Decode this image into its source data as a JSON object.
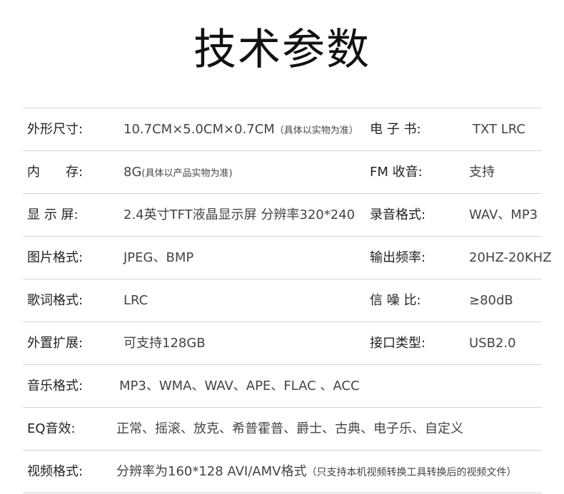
{
  "title": "技术参数",
  "rows": [
    {
      "left_label": "外形尺寸:",
      "left_value": "10.7CM×5.0CM×0.7CM",
      "left_note": "（具体以实物为准）",
      "right_label": "电 子 书:",
      "right_value": "TXT  LRC"
    },
    {
      "left_label": "内　　存:",
      "left_value": "8G",
      "left_note": "(具体以产品实物为准)",
      "right_label": "FM 收音:",
      "right_value": "支持"
    },
    {
      "left_label": "显 示 屏:",
      "left_value": "2.4英寸TFT液晶显示屏 分辨率320*240",
      "right_label": "录音格式:",
      "right_value": "WAV、MP3"
    },
    {
      "left_label": "图片格式:",
      "left_value": "JPEG、BMP",
      "right_label": "输出频率:",
      "right_value": "20HZ-20KHZ"
    },
    {
      "left_label": "歌词格式:",
      "left_value": "LRC",
      "right_label": "信 噪 比:",
      "right_value": "≥80dB"
    },
    {
      "left_label": "外置扩展:",
      "left_value": "可支持128GB",
      "right_label": "接口类型:",
      "right_value": "USB2.0"
    }
  ],
  "full_rows": [
    {
      "label": "音乐格式:",
      "value": "MP3、WMA、WAV、APE、FLAC 、ACC"
    },
    {
      "label": "EQ音效:",
      "value": "正常、摇滚、放克、希普霍普、爵士、古典、电子乐、自定义"
    },
    {
      "label": "视频格式:",
      "value": "分辨率为160*128 AVI/AMV格式",
      "note": "（只支持本机视频转换工具转换后的视频文件）"
    }
  ]
}
